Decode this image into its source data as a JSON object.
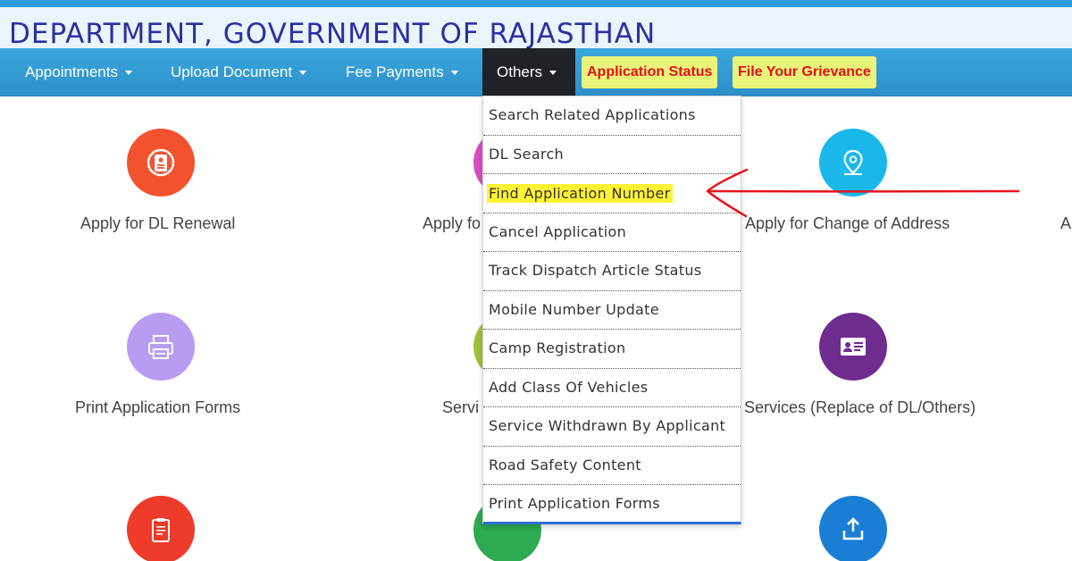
{
  "header": {
    "title": "DEPARTMENT, GOVERNMENT OF RAJASTHAN"
  },
  "nav": {
    "appointments": "Appointments",
    "upload_document": "Upload Document",
    "fee_payments": "Fee Payments",
    "others": "Others",
    "application_status": "Application Status",
    "file_grievance": "File Your Grievance"
  },
  "tiles": {
    "dl_renewal": "Apply for DL Renewal",
    "apply_partial": "Apply fo",
    "change_address": "Apply for Change of Address",
    "right_partial": "A",
    "print_forms": "Print Application Forms",
    "services_partial": "Servi",
    "services_replace": "Services (Replace of DL/Others)"
  },
  "dropdown": {
    "items": [
      "Search Related Applications",
      "DL Search",
      "Find Application Number",
      "Cancel Application",
      "Track Dispatch Article Status",
      "Mobile Number Update",
      "Camp Registration",
      "Add Class Of Vehicles",
      "Service Withdrawn By Applicant",
      "Road Safety Content",
      "Print Application Forms"
    ]
  },
  "colors": {
    "nav_bg": "#3ba7de",
    "title": "#2c2fa3",
    "highlight": "#fff333",
    "annotation_red": "#e8141c"
  },
  "icons": {
    "dl_renewal": "dl-renewal-icon",
    "change_address": "location-pin-icon",
    "print_forms": "printer-icon",
    "services_replace": "id-card-icon"
  }
}
